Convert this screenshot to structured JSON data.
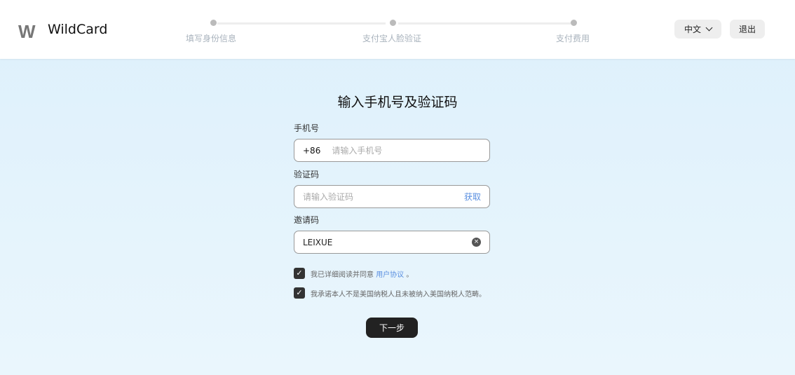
{
  "header": {
    "logo": "W",
    "brand": "WildCard",
    "steps": [
      "填写身份信息",
      "支付宝人脸验证",
      "支付费用"
    ],
    "language": "中文",
    "logout": "退出"
  },
  "form": {
    "title": "输入手机号及验证码",
    "phone": {
      "label": "手机号",
      "prefix": "+86",
      "placeholder": "请输入手机号",
      "value": ""
    },
    "code": {
      "label": "验证码",
      "placeholder": "请输入验证码",
      "get": "获取"
    },
    "invite": {
      "label": "邀请码",
      "value": "LEIXUE"
    },
    "agree1": {
      "text": "我已详细阅读并同意",
      "link": "用户协议",
      "suffix": "。",
      "checked": true
    },
    "agree2": {
      "text": "我承诺本人不是美国纳税人且未被纳入美国纳税人范畴。",
      "checked": true
    },
    "next": "下一步"
  }
}
